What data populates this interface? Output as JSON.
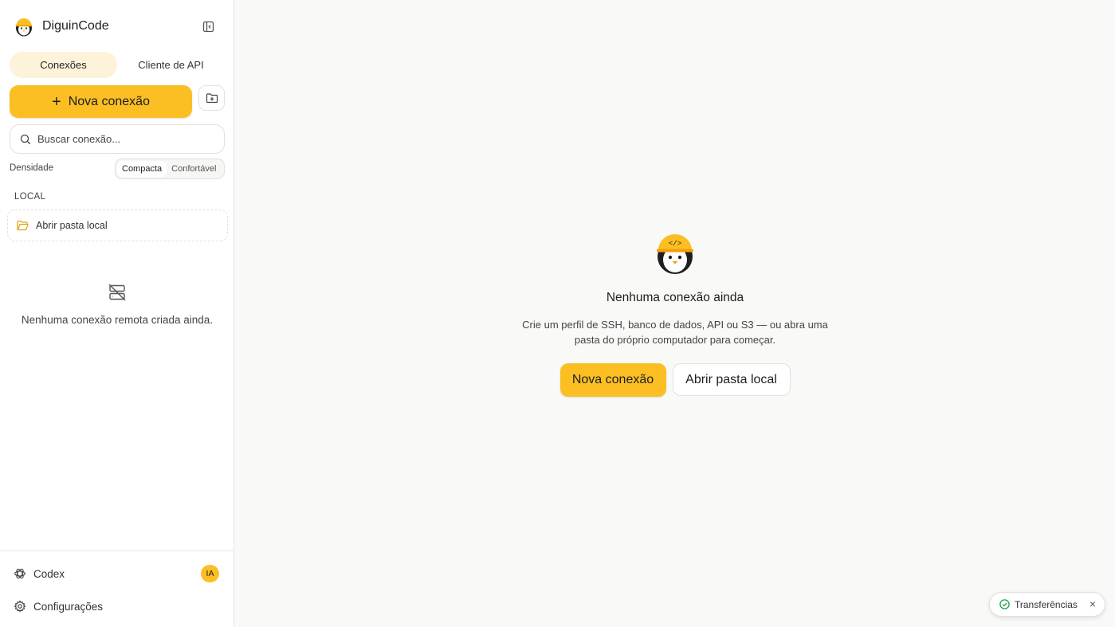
{
  "colors": {
    "accent": "#fbbf24",
    "accent_soft": "#fdf3da",
    "success": "#16a34a"
  },
  "sidebar": {
    "app_name": "DiguinCode",
    "tabs": [
      {
        "label": "Conexões",
        "active": true
      },
      {
        "label": "Cliente de API",
        "active": false
      }
    ],
    "new_connection_label": "Nova conexão",
    "search": {
      "placeholder": "Buscar conexão..."
    },
    "density": {
      "label": "Densidade",
      "options": [
        {
          "label": "Compacta",
          "active": true
        },
        {
          "label": "Confortável",
          "active": false
        }
      ]
    },
    "local_section": {
      "title": "LOCAL",
      "open_folder_label": "Abrir pasta local"
    },
    "empty_remote_text": "Nenhuma conexão remota criada ainda.",
    "footer": {
      "codex_label": "Codex",
      "codex_badge": "IA",
      "settings_label": "Configurações"
    }
  },
  "main": {
    "title": "Nenhuma conexão ainda",
    "description": "Crie um perfil de SSH, banco de dados, API ou S3 — ou abra uma pasta do próprio computador para começar.",
    "primary_button": "Nova conexão",
    "secondary_button": "Abrir pasta local"
  },
  "transfers": {
    "label": "Transferências",
    "close_icon": "×"
  },
  "icons": [
    "penguin-logo-icon",
    "sidebar-collapse-icon",
    "plus-icon",
    "folder-plus-icon",
    "search-icon",
    "folder-icon",
    "server-off-icon",
    "openai-icon",
    "gear-icon",
    "check-circle-icon",
    "close-icon"
  ]
}
